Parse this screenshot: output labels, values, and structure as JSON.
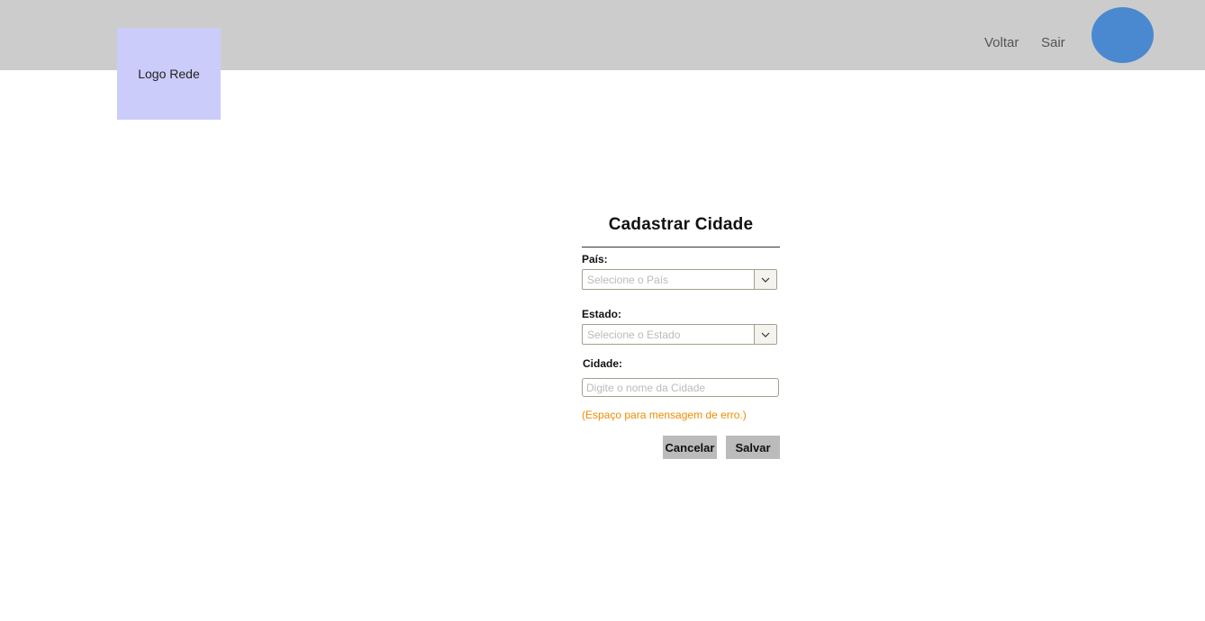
{
  "header": {
    "logo_label": "Logo Rede",
    "nav": {
      "back_label": "Voltar",
      "exit_label": "Sair"
    },
    "avatar_color": "#4a89d0"
  },
  "form": {
    "title": "Cadastrar Cidade",
    "country": {
      "label": "País:",
      "placeholder": "Selecione o País",
      "icon": "chevron-down-icon"
    },
    "state": {
      "label": "Estado:",
      "placeholder": "Selecione o Estado",
      "icon": "chevron-down-icon"
    },
    "city": {
      "label": "Cidade:",
      "placeholder": "Digite o nome da Cidade",
      "value": ""
    },
    "error_message": "(Espaço para mensagem de erro.)",
    "error_color": "#f08c00",
    "cancel_label": "Cancelar",
    "save_label": "Salvar"
  }
}
